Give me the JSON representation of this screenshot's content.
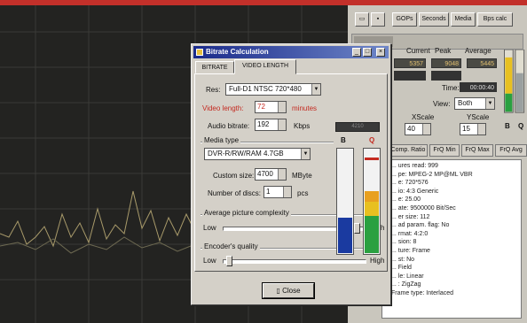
{
  "toolbar": {
    "buttons": [
      "GOPs",
      "Seconds",
      "Media",
      "Bps calc"
    ]
  },
  "stats": {
    "headers": [
      "Current",
      "Peak",
      "Average"
    ],
    "values": [
      "5357",
      "9048",
      "5445"
    ],
    "row2": [
      "",
      ""
    ],
    "time_label": "Time:",
    "time_value": "00:00:40",
    "view_label": "View:",
    "view_value": "Both",
    "xscale_label": "XScale",
    "xscale_value": "40",
    "yscale_label": "YScale",
    "yscale_value": "15",
    "meter_labels": [
      "B",
      "Q"
    ]
  },
  "tabs2": [
    "Comp. Ratio",
    "FrQ Min",
    "FrQ Max",
    "FrQ Avg"
  ],
  "info_lines": [
    "... ures read: 999",
    "... pe: MPEG-2  MP@ML  VBR",
    "... e: 720*576",
    "... io: 4:3 Generic",
    "... e: 25.00",
    "... ate: 9500000 Bit/Sec",
    "... er size: 112",
    "... ad param. flag: No",
    "... rmat: 4:2:0",
    "... sion: 8",
    "... ture: Frame",
    "... st: No",
    "... Field",
    "... le: Linear",
    "... : ZigZag",
    "Frame type: Interlaced"
  ],
  "dialog": {
    "title": "Bitrate Calculation",
    "tabs": [
      "BITRATE",
      "VIDEO LENGTH"
    ],
    "res_label": "Res:",
    "res_value": "Full-D1 NTSC 720*480",
    "video_length_label": "Video length:",
    "video_length_value": "72",
    "video_length_unit": "minutes",
    "audio_bitrate_label": "Audio bitrate:",
    "audio_bitrate_value": "192",
    "audio_bitrate_unit": "Kbps",
    "media_type_title": "Media type",
    "media_type_value": "DVR-R/RW/RAM 4.7GB",
    "custom_size_label": "Custom size:",
    "custom_size_value": "4700",
    "custom_size_unit": "MByte",
    "discs_label": "Number of discs:",
    "discs_value": "1",
    "discs_unit": "pcs",
    "complexity_title": "Average picture complexity",
    "encoder_title": "Encoder's quality",
    "low": "Low",
    "high": "High",
    "close": "Close",
    "meter_display": "4210",
    "meter_letters": [
      "B",
      "Q"
    ]
  },
  "colors": {
    "accent_red": "#c42a20",
    "meter_blue": "#1a3aa0",
    "meter_green": "#2aa040",
    "meter_yellow": "#e8c020",
    "title_blue": "#1a2a8a"
  }
}
